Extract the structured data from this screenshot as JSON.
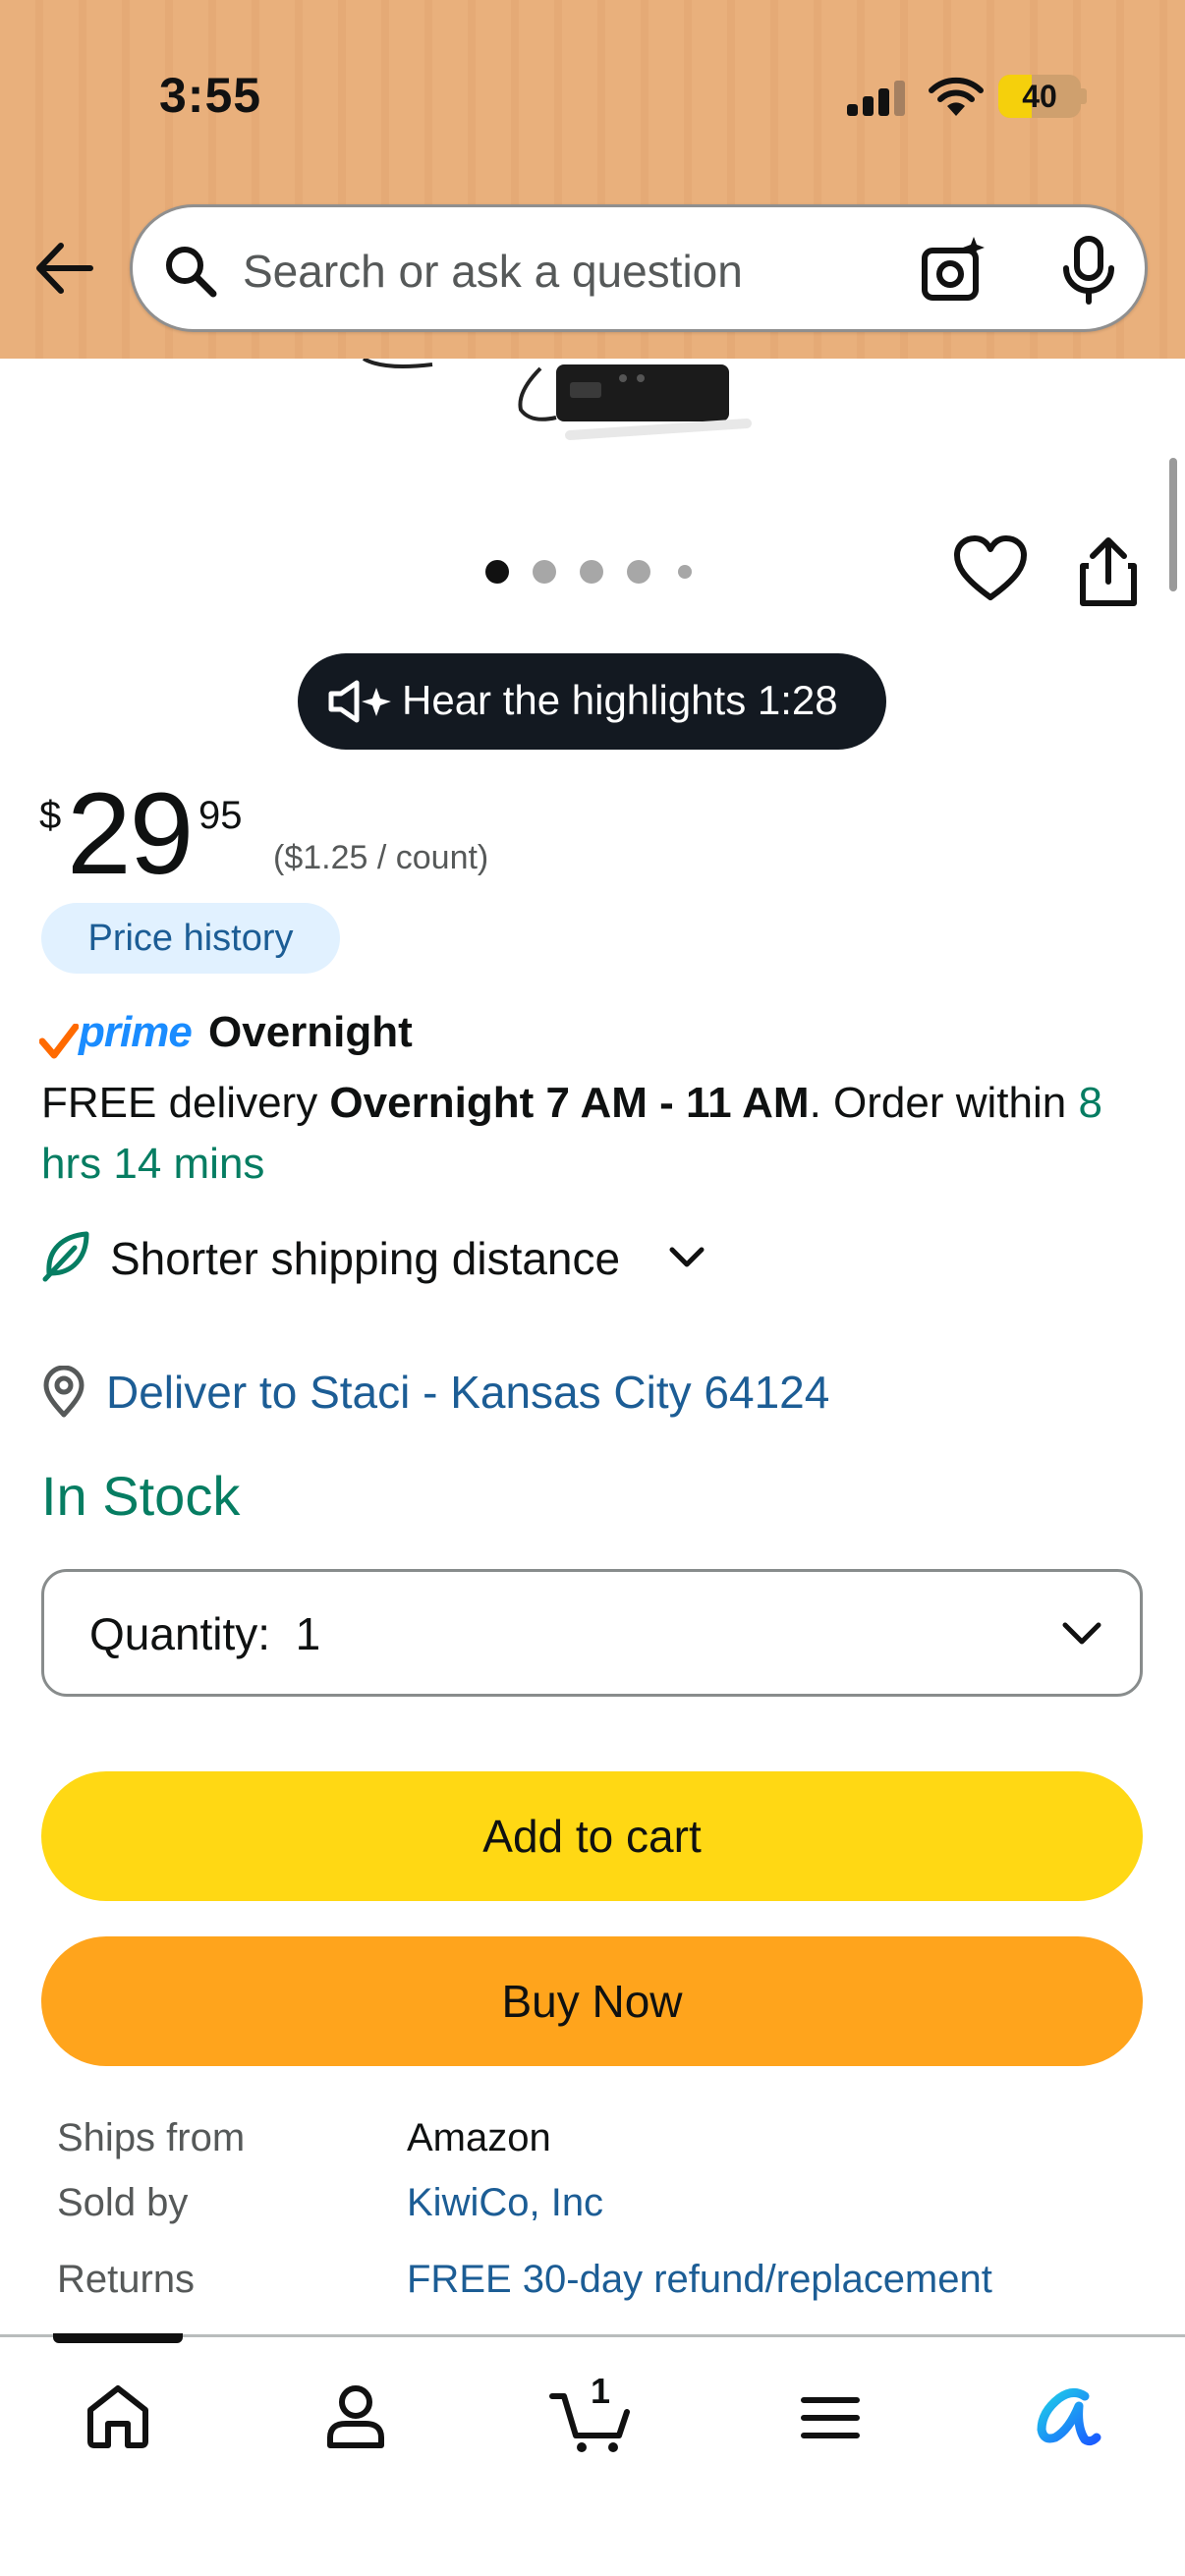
{
  "status_bar": {
    "time": "3:55",
    "battery": "40"
  },
  "search": {
    "placeholder": "Search or ask a question"
  },
  "gallery": {
    "dot_count": 5,
    "active_index": 0
  },
  "audio_summary": {
    "label": "Hear the highlights 1:28"
  },
  "price": {
    "symbol": "$",
    "whole": "29",
    "fraction": "95",
    "unit_price": "($1.25 / count)"
  },
  "price_history_label": "Price history",
  "prime": {
    "brand": "prime",
    "tier": "Overnight"
  },
  "delivery": {
    "prefix": "FREE delivery ",
    "window": "Overnight 7 AM - 11 AM",
    "middle": ". Order within ",
    "countdown": "8 hrs 14 mins"
  },
  "shipping_distance": {
    "label": "Shorter shipping distance"
  },
  "deliver_to": {
    "label": "Deliver to Staci - Kansas City 64124"
  },
  "availability": "In Stock",
  "quantity": {
    "label": "Quantity:",
    "value": "1"
  },
  "buttons": {
    "add_to_cart": "Add to cart",
    "buy_now": "Buy Now"
  },
  "details": [
    {
      "key": "Ships from",
      "value": "Amazon",
      "link": false
    },
    {
      "key": "Sold by",
      "value": "KiwiCo, Inc",
      "link": true
    },
    {
      "key": "Returns",
      "value": "FREE 30-day refund/replacement",
      "link": true
    }
  ],
  "bottom_nav": {
    "cart_count": "1"
  },
  "colors": {
    "header_bg": "#e9b07c",
    "add_to_cart": "#ffd814",
    "buy_now": "#ffa41c",
    "link": "#1c5d95",
    "in_stock": "#067d62",
    "prime_blue": "#1a8cff"
  },
  "icons": [
    "back-arrow-icon",
    "search-icon",
    "camera-sparkle-icon",
    "microphone-icon",
    "heart-icon",
    "share-icon",
    "speaker-sparkle-icon",
    "leaf-icon",
    "location-pin-icon",
    "chevron-down-icon",
    "home-icon",
    "person-icon",
    "cart-icon",
    "menu-icon",
    "rufus-ai-icon"
  ]
}
